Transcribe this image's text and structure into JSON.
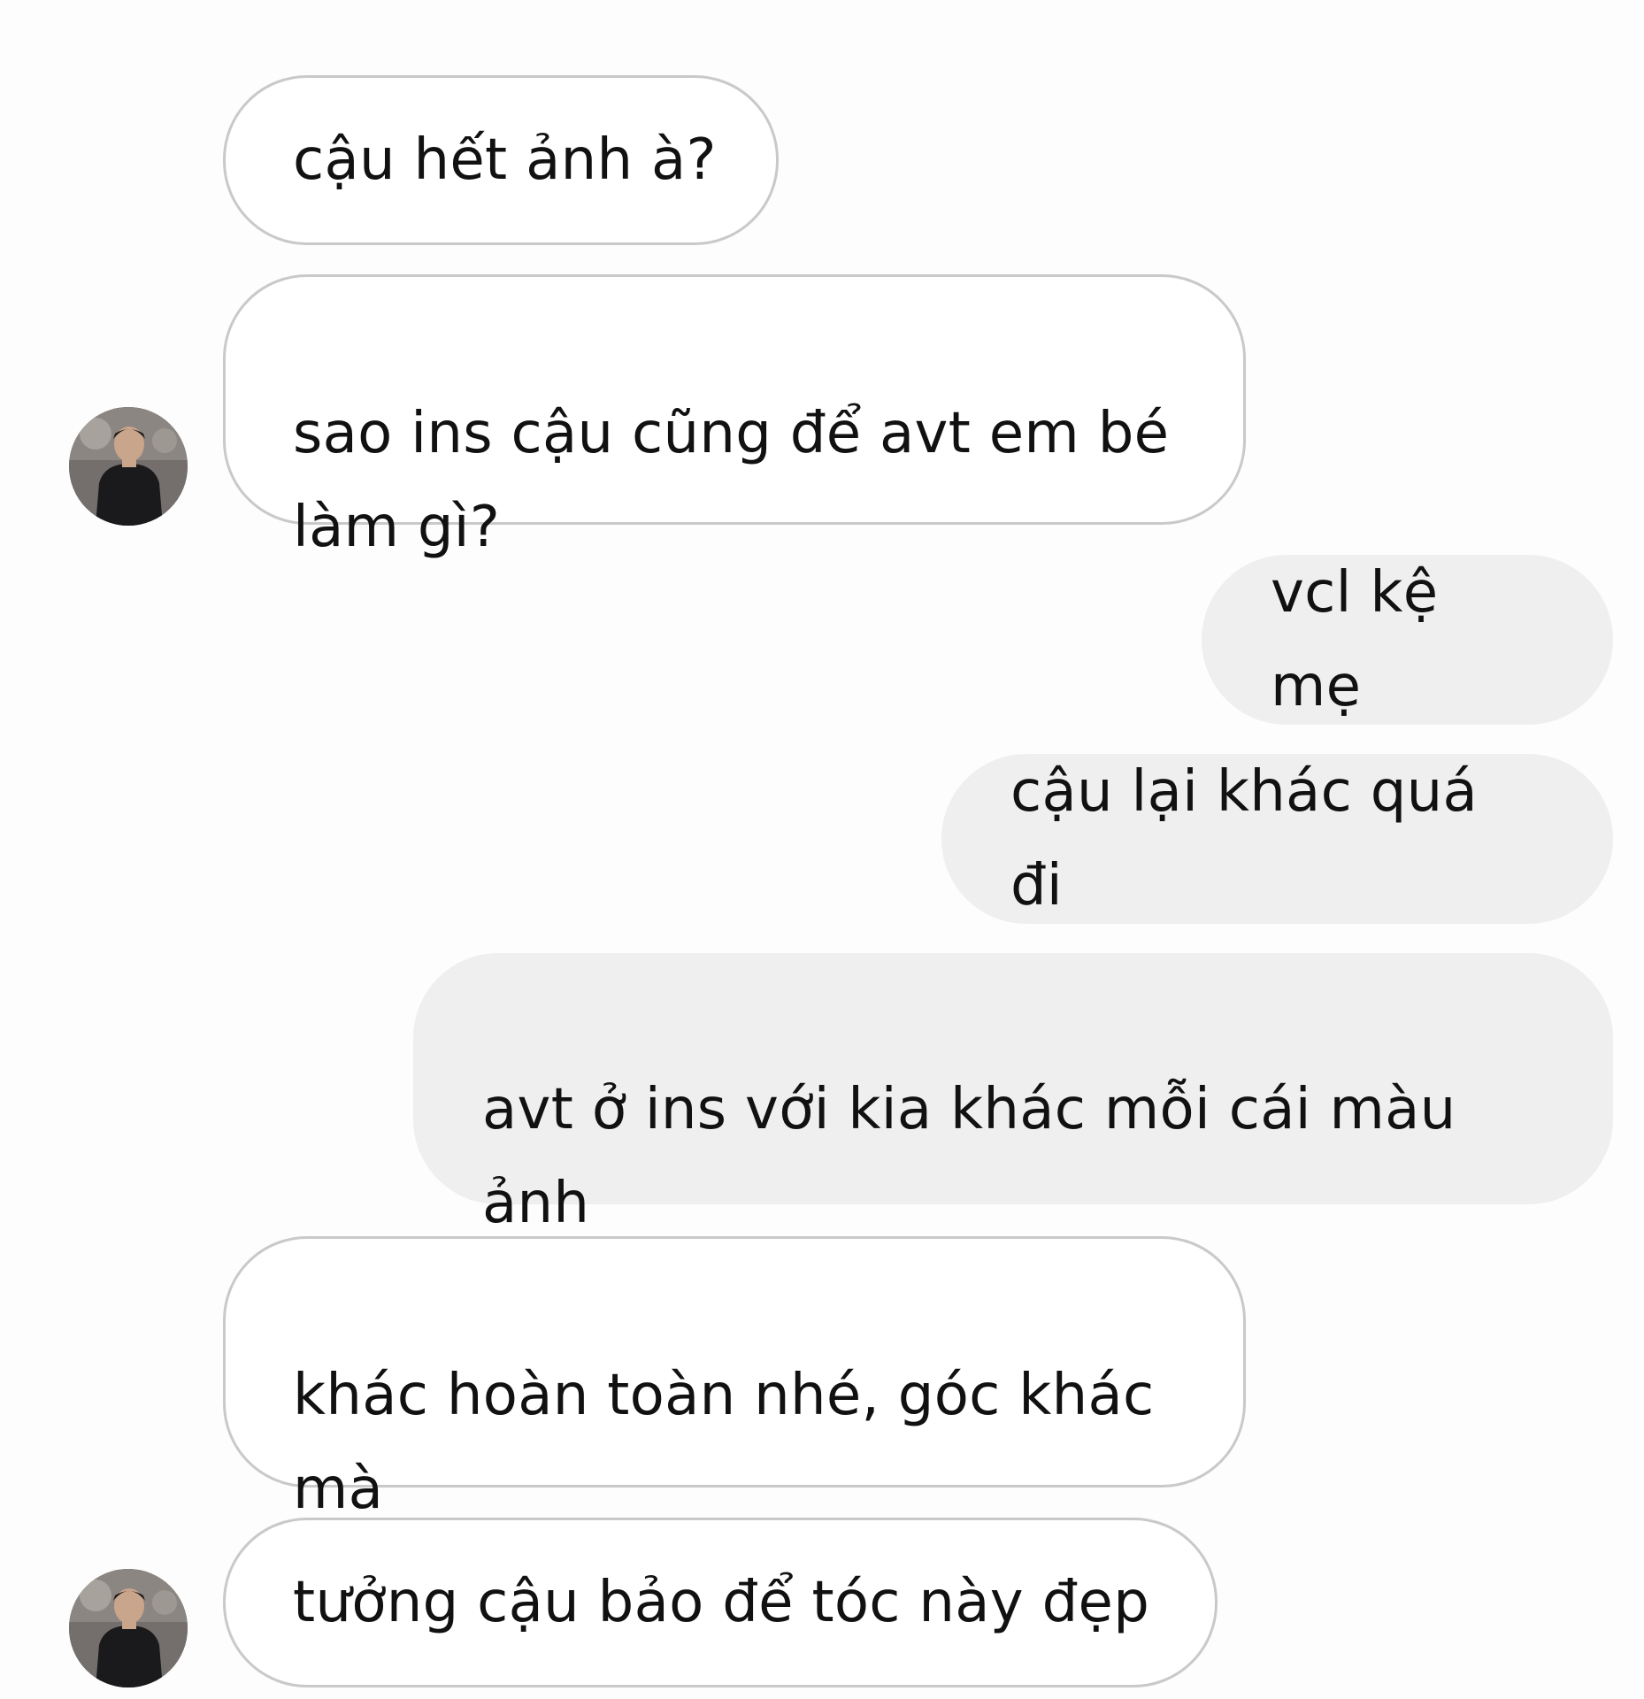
{
  "messages": [
    {
      "side": "incoming",
      "text": "cậu hết ảnh à?"
    },
    {
      "side": "incoming",
      "text": "sao ins cậu cũng để avt em bé\nlàm gì?"
    },
    {
      "side": "outgoing",
      "text": "vcl kệ mẹ"
    },
    {
      "side": "outgoing",
      "text": "cậu lại khác quá đi"
    },
    {
      "side": "outgoing",
      "text": "avt ở ins với kia khác mỗi cái màu\nảnh"
    },
    {
      "side": "incoming",
      "text": "khác hoàn toàn nhé, góc khác\nmà"
    },
    {
      "side": "incoming",
      "text": "tưởng cậu bảo để tóc này đẹp"
    }
  ],
  "avatar_icon": "profile-photo-avatar",
  "colors": {
    "incoming_bubble_bg": "#ffffff",
    "incoming_bubble_border": "#c9c9cc",
    "outgoing_bubble_bg": "#efefef",
    "text": "#111111"
  }
}
